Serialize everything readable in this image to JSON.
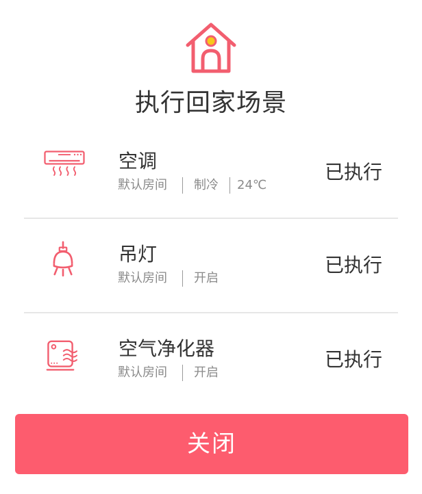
{
  "scene": {
    "title": "执行回家场景",
    "icon": "home-icon"
  },
  "colors": {
    "accent": "#fd5c6e",
    "icon_stroke": "#f25e6f",
    "icon_dot": "#f8c71a",
    "text_primary": "#333333",
    "text_secondary": "#8a8a8a",
    "divider": "#e6e6e6"
  },
  "devices": [
    {
      "icon": "air-conditioner-icon",
      "name": "空调",
      "room": "默认房间",
      "details": [
        "制冷",
        "24℃"
      ],
      "status": "已执行"
    },
    {
      "icon": "pendant-lamp-icon",
      "name": "吊灯",
      "room": "默认房间",
      "details": [
        "开启"
      ],
      "status": "已执行"
    },
    {
      "icon": "air-purifier-icon",
      "name": "空气净化器",
      "room": "默认房间",
      "details": [
        "开启"
      ],
      "status": "已执行"
    }
  ],
  "footer": {
    "close_label": "关闭"
  }
}
